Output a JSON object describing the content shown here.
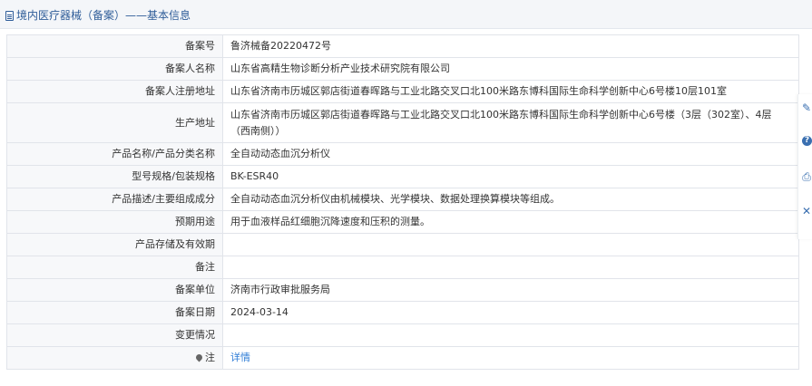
{
  "header": {
    "title": "境内医疗器械（备案）——基本信息"
  },
  "rows": [
    {
      "label": "备案号",
      "value": "鲁济械备20220472号"
    },
    {
      "label": "备案人名称",
      "value": "山东省高精生物诊断分析产业技术研究院有限公司"
    },
    {
      "label": "备案人注册地址",
      "value": "山东省济南市历城区郭店街道春晖路与工业北路交叉口北100米路东博科国际生命科学创新中心6号楼10层101室"
    },
    {
      "label": "生产地址",
      "value": "山东省济南市历城区郭店街道春晖路与工业北路交叉口北100米路东博科国际生命科学创新中心6号楼（3层（302室）、4层（西南侧））"
    },
    {
      "label": "产品名称/产品分类名称",
      "value": "全自动动态血沉分析仪"
    },
    {
      "label": "型号规格/包装规格",
      "value": "BK-ESR40"
    },
    {
      "label": "产品描述/主要组成成分",
      "value": "全自动动态血沉分析仪由机械模块、光学模块、数据处理换算模块等组成。"
    },
    {
      "label": "预期用途",
      "value": "用于血液样品红细胞沉降速度和压积的测量。"
    },
    {
      "label": "产品存储及有效期",
      "value": ""
    },
    {
      "label": "备注",
      "value": ""
    },
    {
      "label": "备案单位",
      "value": "济南市行政审批服务局"
    },
    {
      "label": "备案日期",
      "value": "2024-03-14"
    },
    {
      "label": "变更情况",
      "value": ""
    },
    {
      "label": "注",
      "value": "详情"
    }
  ],
  "icons": {
    "header": "document-icon",
    "note": "pin-icon"
  },
  "rail": [
    {
      "icon": "edit-icon",
      "glyph": "✎"
    },
    {
      "icon": "help-icon",
      "glyph": "?"
    },
    {
      "icon": "print-icon",
      "glyph": "⎙"
    },
    {
      "icon": "close-icon",
      "glyph": "✕"
    }
  ],
  "colors": {
    "title": "#2f5d99",
    "link": "#2e7cd6",
    "label_bg": "#f7f8fa",
    "border": "#e1e4ea"
  }
}
